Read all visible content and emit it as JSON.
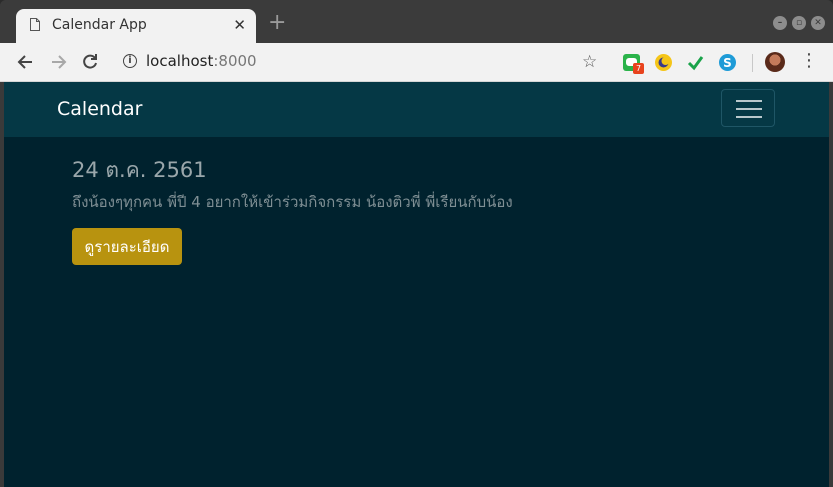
{
  "browser": {
    "tab_title": "Calendar App",
    "tab_close": "✕",
    "new_tab": "+",
    "url_host": "localhost",
    "url_port": ":8000",
    "extension_badge": "7"
  },
  "navbar": {
    "brand": "Calendar"
  },
  "event": {
    "date": "24 ต.ค. 2561",
    "description": "ถึงน้องๆทุกคน พี่ปี 4 อยากให้เข้าร่วมกิจกรรม น้องติวพี่ พี่เรียนกับน้อง",
    "details_button": "ดูรายละเอียด"
  },
  "colors": {
    "page_bg": "#00222e",
    "navbar_bg": "#053845",
    "button_bg": "#b8930f"
  }
}
